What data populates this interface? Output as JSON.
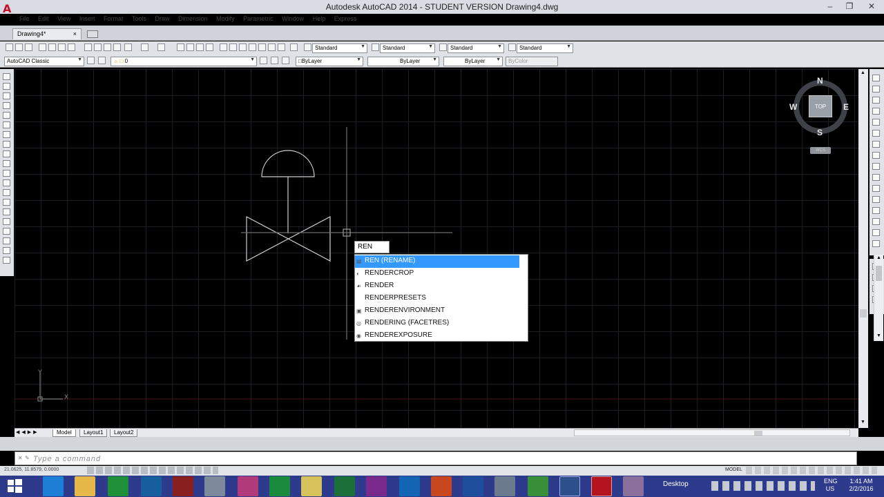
{
  "window": {
    "title": "Autodesk AutoCAD 2014 - STUDENT VERSION    Drawing4.dwg",
    "logo": "A"
  },
  "menu": [
    "File",
    "Edit",
    "View",
    "Insert",
    "Format",
    "Tools",
    "Draw",
    "Dimension",
    "Modify",
    "Parametric",
    "Window",
    "Help",
    "Express"
  ],
  "tabs": {
    "drawing": "Drawing4*",
    "close": "×"
  },
  "toolbar": {
    "text_style": "Standard",
    "dim_style": "Standard",
    "table_style": "Standard",
    "mleader_style": "Standard",
    "workspace": "AutoCAD Classic",
    "layer": "0",
    "color": "ByLayer",
    "linetype": "ByLayer",
    "lineweight": "ByLayer",
    "plot_style": "ByColor"
  },
  "viewcube": {
    "n": "N",
    "s": "S",
    "e": "E",
    "w": "W",
    "top": "TOP",
    "wcs": "WCS"
  },
  "ucs": {
    "x": "X",
    "y": "Y"
  },
  "command_input": "REN",
  "autocomplete": [
    {
      "label": "REN (RENAME)",
      "icon": "rename-icon"
    },
    {
      "label": "RENDERCROP",
      "icon": "render-crop-icon"
    },
    {
      "label": "RENDER",
      "icon": "render-icon"
    },
    {
      "label": "RENDERPRESETS",
      "icon": ""
    },
    {
      "label": "RENDERENVIRONMENT",
      "icon": "render-environment-icon"
    },
    {
      "label": "RENDERING (FACETRES)",
      "icon": "facetres-icon"
    },
    {
      "label": "RENDEREXPOSURE",
      "icon": "render-exposure-icon"
    }
  ],
  "layout_tabs": [
    "Model",
    "Layout1",
    "Layout2"
  ],
  "command_line": {
    "placeholder": "Type a command"
  },
  "status": {
    "coords": "21.0625, 11.8579, 0.0000",
    "model": "MODEL"
  },
  "taskbar": {
    "desktop": "Desktop",
    "lang": [
      "ENG",
      "US"
    ],
    "time": "1:41 AM",
    "date": "2/2/2016"
  },
  "colors": {
    "selection": "#3399ff",
    "taskbar": "#2e3a8c",
    "drawing_bg": "#000000",
    "geometry": "#cfcfcf"
  }
}
